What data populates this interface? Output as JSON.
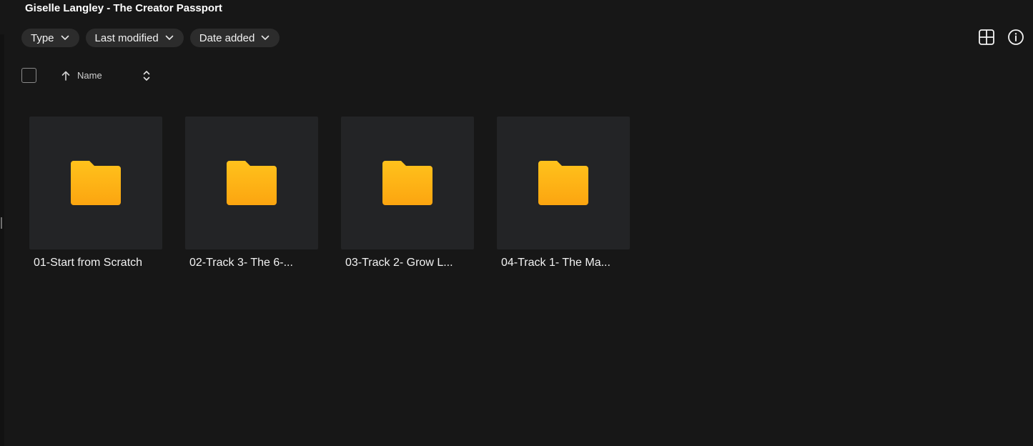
{
  "page": {
    "title": "Giselle Langley - The Creator Passport"
  },
  "filters": [
    {
      "label": "Type",
      "icon": "chevron-down-icon"
    },
    {
      "label": "Last modified",
      "icon": "chevron-down-icon"
    },
    {
      "label": "Date added",
      "icon": "chevron-down-icon"
    }
  ],
  "toolbar": {
    "view_icon": "grid-view-icon",
    "info_icon": "info-icon"
  },
  "list_header": {
    "sort_column": "Name",
    "sort_direction_icon": "arrow-up-icon",
    "sort_toggle_icon": "sort-toggle-icon"
  },
  "folders": [
    {
      "name": "01-Start from Scratch",
      "icon": "folder-icon"
    },
    {
      "name": "02-Track 3- The 6-...",
      "icon": "folder-icon"
    },
    {
      "name": "03-Track 2- Grow L...",
      "icon": "folder-icon"
    },
    {
      "name": "04-Track 1- The Ma...",
      "icon": "folder-icon"
    }
  ],
  "colors": {
    "background": "#171717",
    "chip": "#2c2c2c",
    "card": "#232426",
    "folder_top": "#ffc21c",
    "folder_bottom": "#fca510",
    "text": "#f2f2f2"
  }
}
